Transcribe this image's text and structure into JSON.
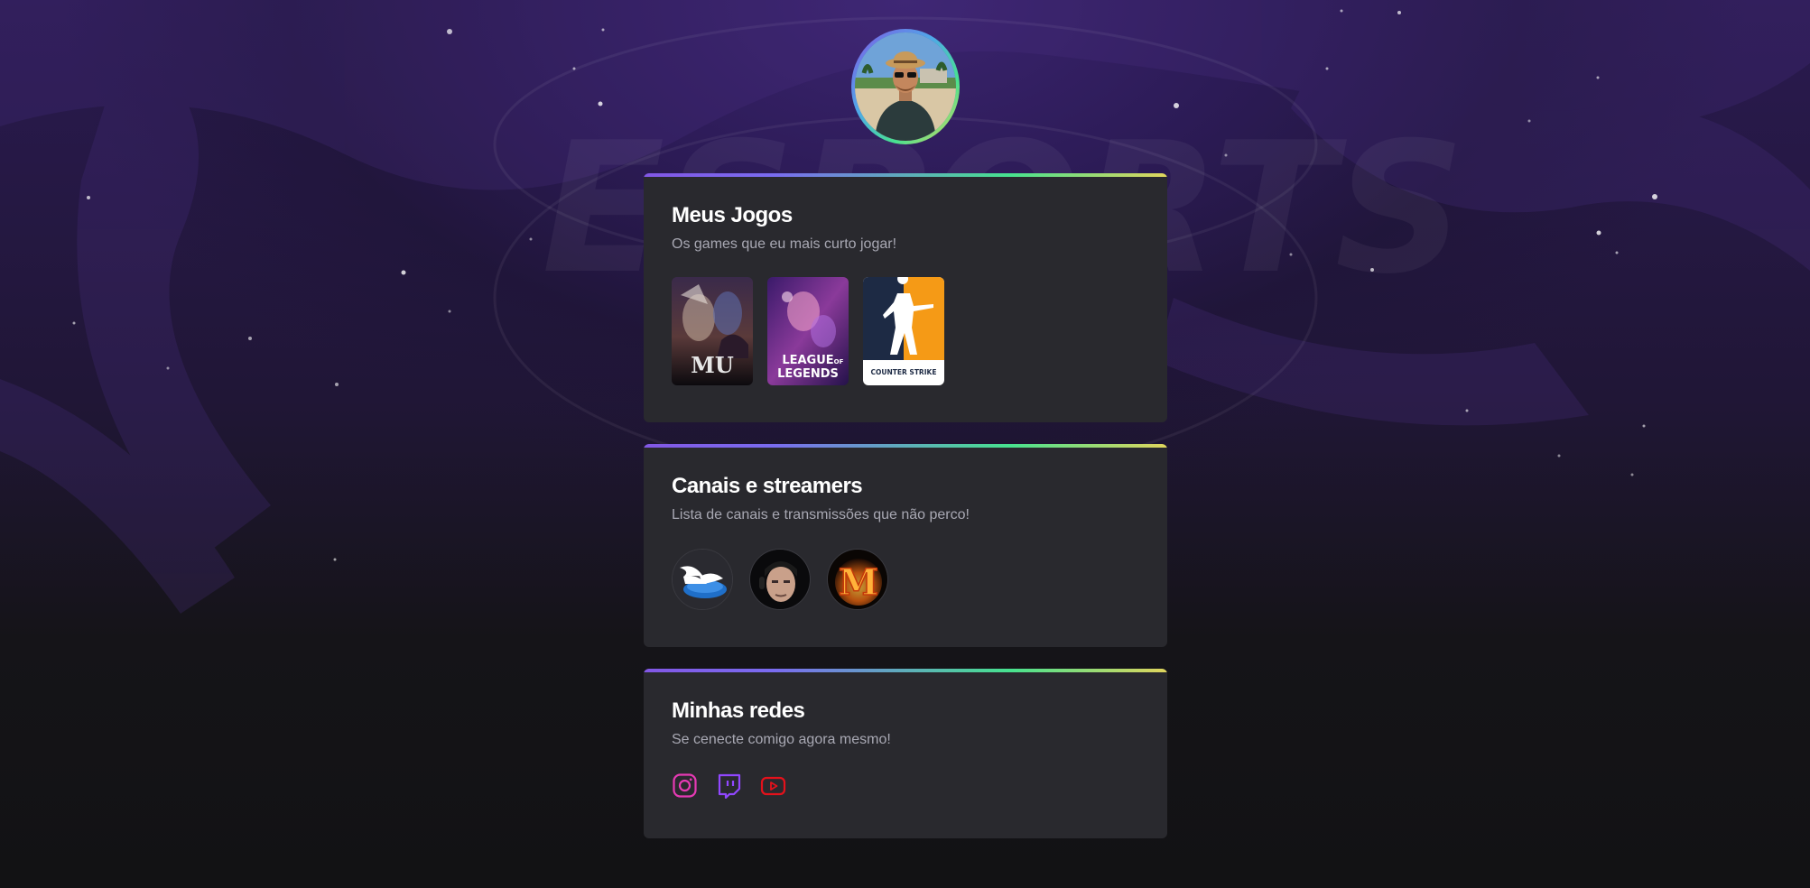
{
  "profile": {
    "avatar_alt": "Profile photo"
  },
  "games_card": {
    "title": "Meus Jogos",
    "subtitle": "Os games que eu mais curto jogar!",
    "games": [
      {
        "name": "MU",
        "label": "MU"
      },
      {
        "name": "League of Legends",
        "label_top": "LEAGUE",
        "label_of": "OF",
        "label_bottom": "LEGENDS"
      },
      {
        "name": "Counter-Strike",
        "label": "COUNTER STRIKE"
      }
    ]
  },
  "streams_card": {
    "title": "Canais e streamers",
    "subtitle": "Lista de canais e transmissões que não perco!",
    "streamers": [
      {
        "icon": "winged-shoe-icon"
      },
      {
        "icon": "streamer-face-icon"
      },
      {
        "icon": "flaming-m-icon",
        "letter": "M"
      }
    ]
  },
  "social_card": {
    "title": "Minhas redes",
    "subtitle": "Se cenecte comigo agora mesmo!",
    "networks": [
      {
        "icon": "instagram-icon",
        "color": "#e63ab4"
      },
      {
        "icon": "twitch-icon",
        "color": "#9147ff"
      },
      {
        "icon": "youtube-icon",
        "color": "#e4111b"
      }
    ]
  },
  "colors": {
    "background": "#121214",
    "card": "#29292e",
    "purple": "#8257e5",
    "green": "#47e28f",
    "yellow": "#e1d55d"
  }
}
